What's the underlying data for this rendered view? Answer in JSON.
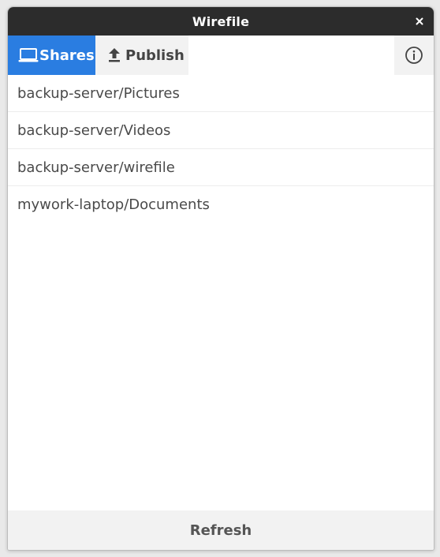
{
  "window": {
    "title": "Wirefile"
  },
  "tabs": [
    {
      "label": "Shares",
      "icon": "laptop-icon",
      "active": true
    },
    {
      "label": "Publish",
      "icon": "upload-icon",
      "active": false
    }
  ],
  "info_icon": "info-icon",
  "shares": [
    "backup-server/Pictures",
    "backup-server/Videos",
    "backup-server/wirefile",
    "mywork-laptop/Documents"
  ],
  "footer": {
    "refresh_label": "Refresh"
  },
  "colors": {
    "titlebar": "#2c2c2c",
    "accent": "#2a7de1",
    "toolbar_inactive": "#f2f2f2"
  }
}
